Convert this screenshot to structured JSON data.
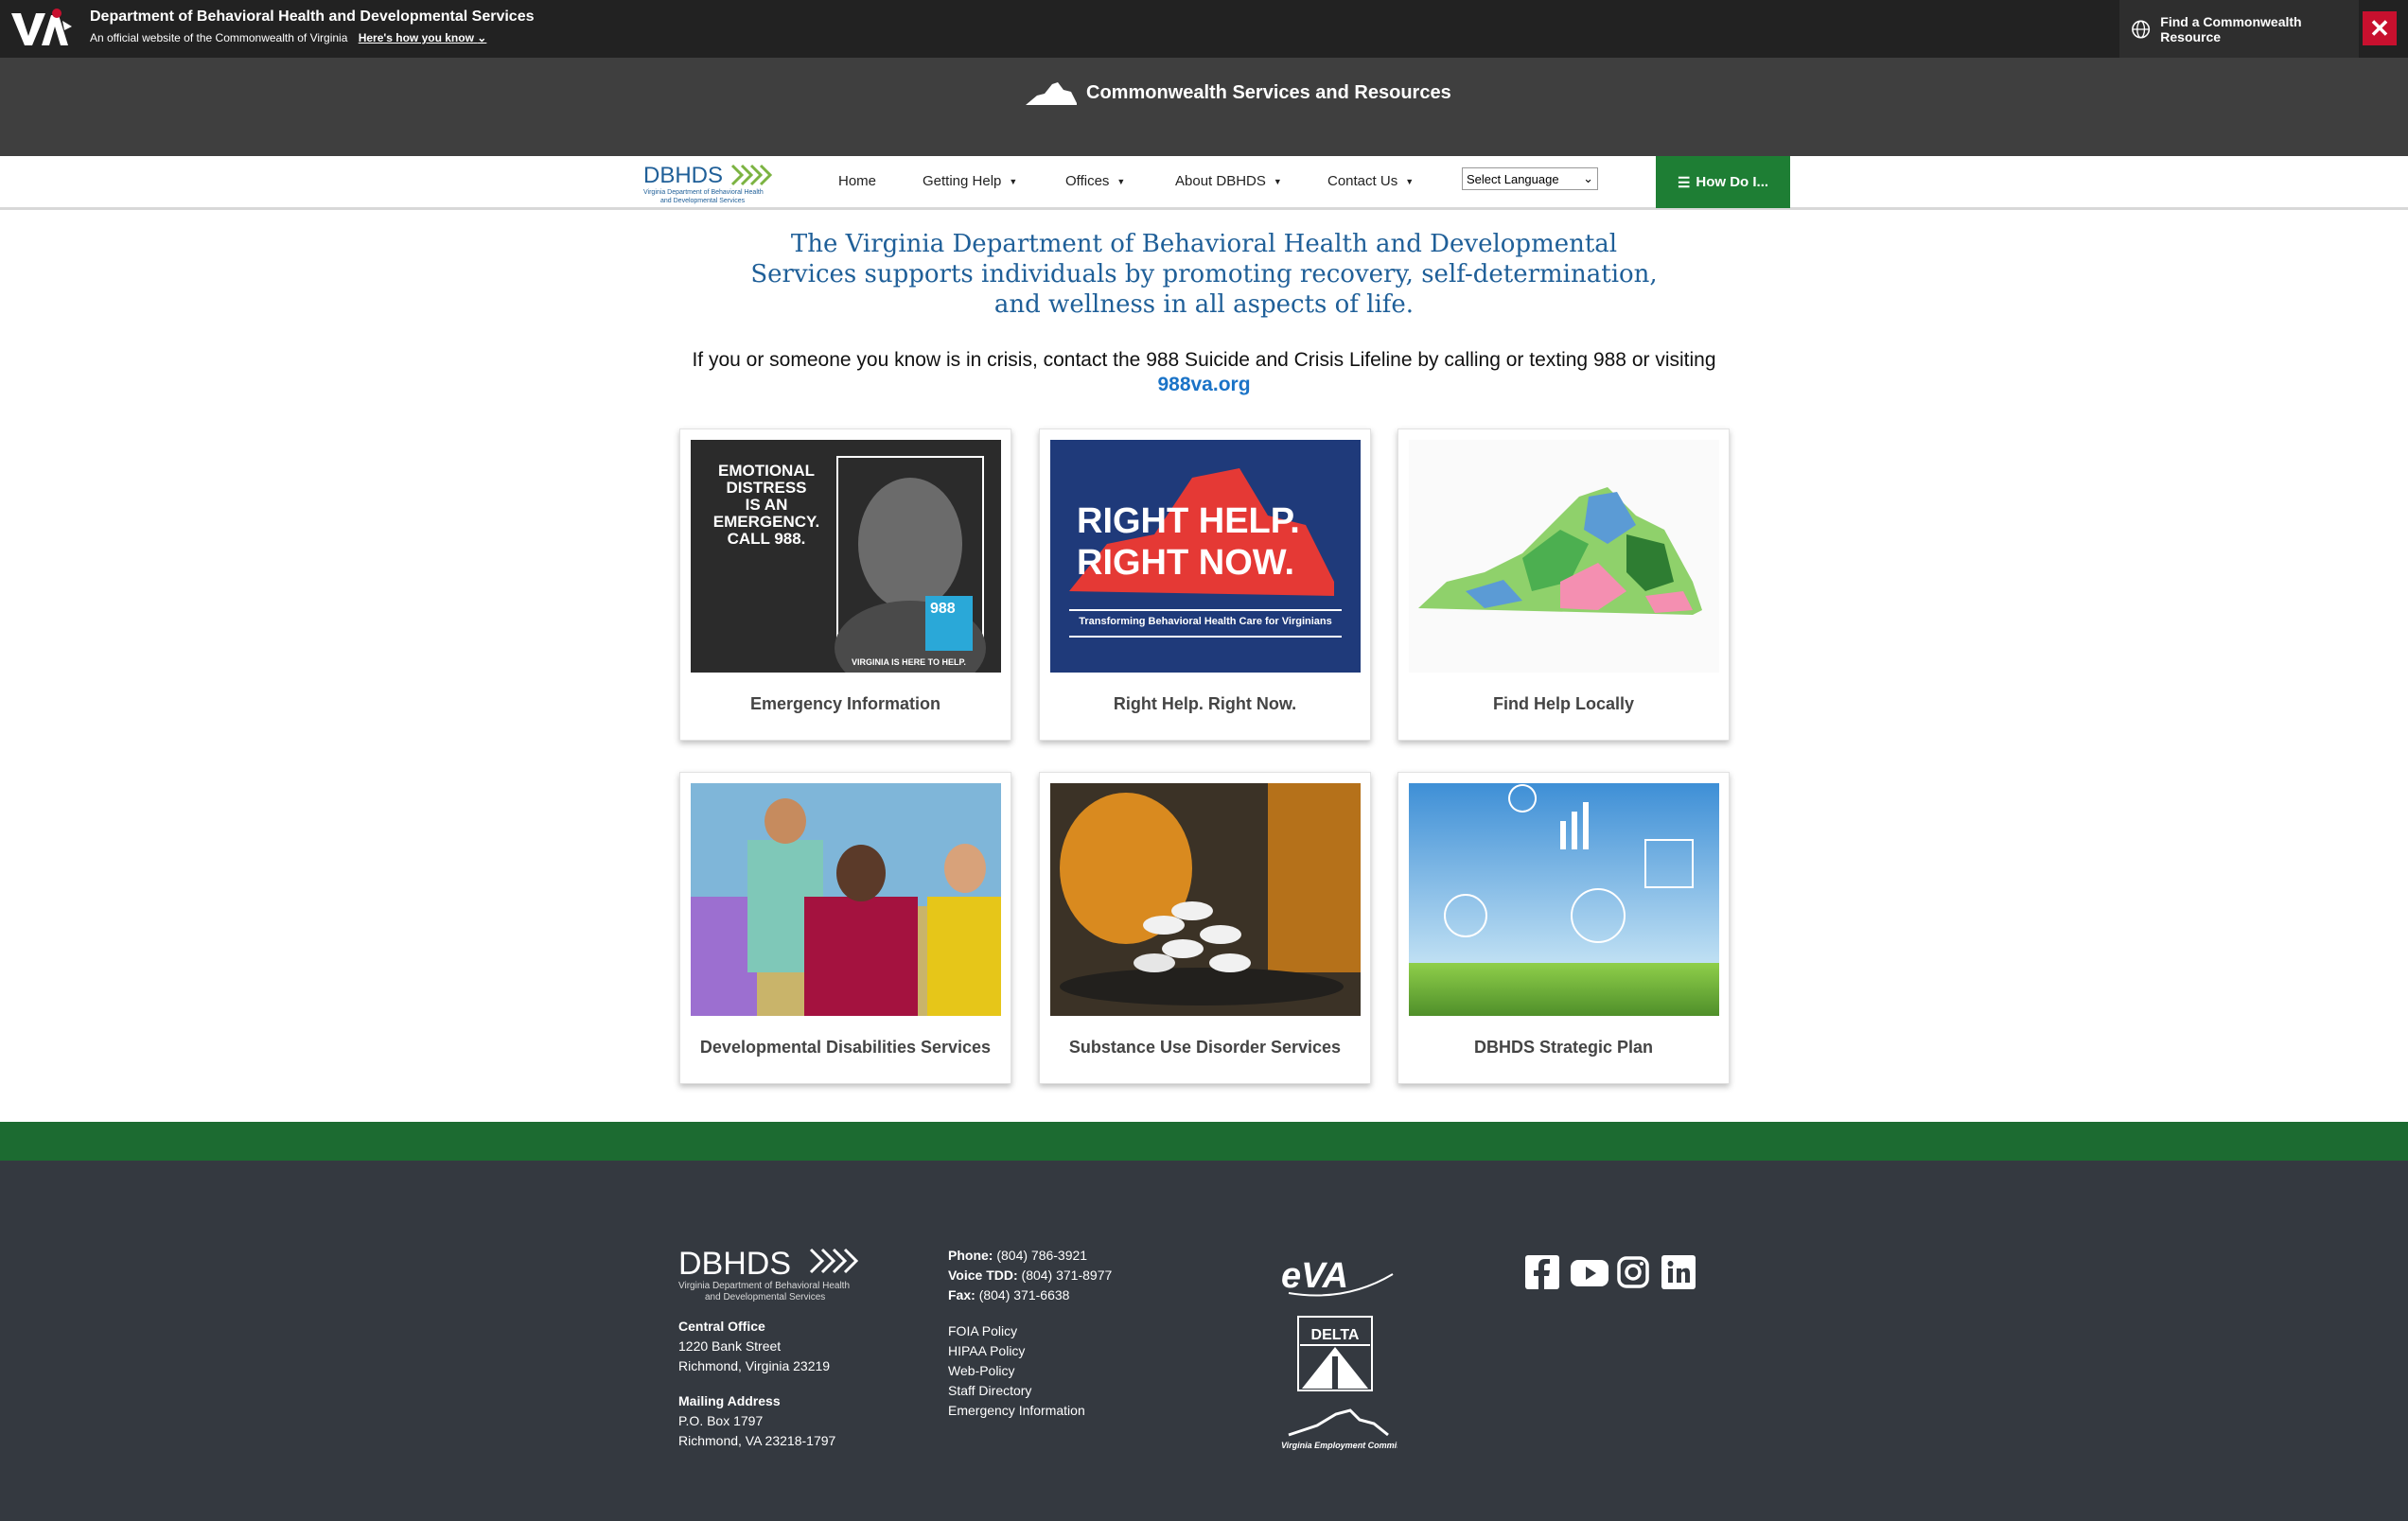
{
  "topbar": {
    "agency": "Department of Behavioral Health and Developmental Services",
    "official": "An official website of the Commonwealth of Virginia",
    "how_know": "Here's how you know",
    "find_resource": "Find a Commonwealth Resource",
    "close_icon": "close-icon"
  },
  "cwbar": {
    "title": "Commonwealth Services and Resources"
  },
  "nav": {
    "logo_text": "DBHDS",
    "logo_sub": "Virginia Department of Behavioral Health and Developmental Services",
    "items": [
      {
        "label": "Home"
      },
      {
        "label": "Getting Help"
      },
      {
        "label": "Offices"
      },
      {
        "label": "About DBHDS"
      },
      {
        "label": "Contact Us"
      }
    ],
    "language": "Select Language",
    "how_do_i": "How Do I..."
  },
  "mission": "The Virginia Department of Behavioral Health and Developmental Services supports individuals by promoting recovery, self-determination, and wellness in all aspects of life.",
  "crisis": {
    "text": "If you or someone you know is in crisis, contact the 988 Suicide and Crisis Lifeline by calling or texting 988 or visiting",
    "link": "988va.org"
  },
  "cards": [
    {
      "label": "Emergency Information",
      "img_text": [
        "EMOTIONAL",
        "DISTRESS",
        "IS AN",
        "EMERGENCY.",
        "CALL 988."
      ],
      "img_sub": "VIRGINIA IS HERE TO HELP.",
      "badge": "988"
    },
    {
      "label": "Right Help. Right Now.",
      "img_text": [
        "RIGHT HELP.",
        "RIGHT NOW."
      ],
      "img_sub": "Transforming Behavioral Health Care for Virginians"
    },
    {
      "label": "Find Help Locally"
    },
    {
      "label": "Developmental Disabilities Services"
    },
    {
      "label": "Substance Use Disorder Services"
    },
    {
      "label": "DBHDS Strategic Plan"
    }
  ],
  "footer": {
    "logo_text": "DBHDS",
    "logo_sub1": "Virginia Department of Behavioral Health",
    "logo_sub2": "and Developmental Services",
    "central_office_label": "Central Office",
    "central_office_line1": "1220 Bank Street",
    "central_office_line2": "Richmond, Virginia 23219",
    "mailing_label": "Mailing Address",
    "mailing_line1": "P.O. Box 1797",
    "mailing_line2": "Richmond, VA 23218-1797",
    "phone_label": "Phone:",
    "phone": "(804) 786-3921",
    "tdd_label": "Voice TDD:",
    "tdd": "(804) 371-8977",
    "fax_label": "Fax:",
    "fax": "(804) 371-6638",
    "policies": [
      "FOIA Policy",
      "HIPAA Policy",
      "Web-Policy",
      "Staff Directory",
      "Emergency Information"
    ],
    "partners": [
      "eVA",
      "DELTA",
      "Virginia Employment Commission"
    ],
    "social": [
      "facebook-icon",
      "youtube-icon",
      "instagram-icon",
      "linkedin-icon"
    ]
  },
  "colors": {
    "topbar": "#222222",
    "cwbar": "#3f3f3f",
    "accent_green": "#1e7e34",
    "mission_blue": "#1f5f98",
    "footer": "#343940"
  }
}
